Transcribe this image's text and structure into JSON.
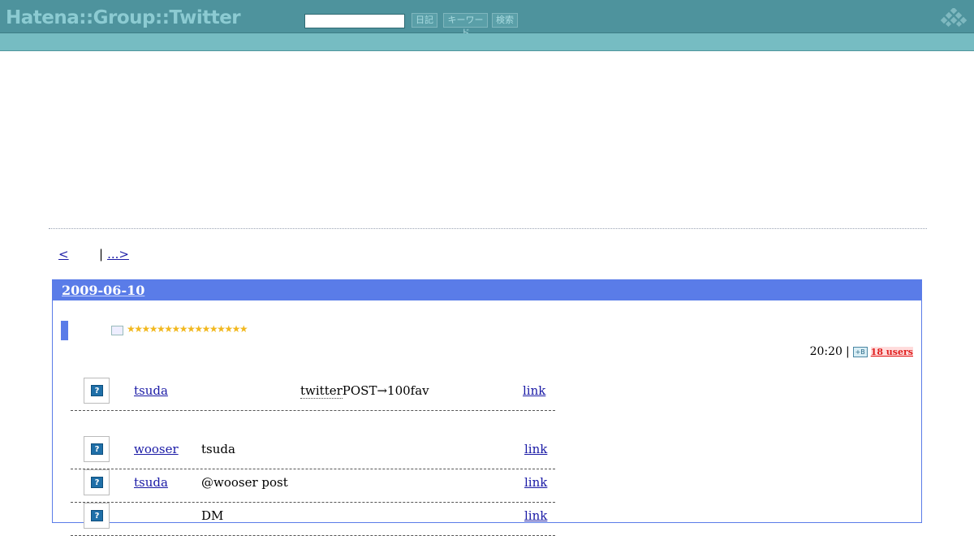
{
  "header": {
    "site_title": "Hatena::Group::Twitter",
    "search": {
      "value": "",
      "placeholder": ""
    },
    "buttons": {
      "diary": "日記",
      "keyword": "キーワード",
      "search": "検索"
    },
    "corner_icon": "hatena-diamond-logo-icon"
  },
  "pager": {
    "prev": "<",
    "separator": "|",
    "next": "...>"
  },
  "day": {
    "date": "2009-06-10",
    "star_icon": "star-icon",
    "stars": "★★★★★★★★★★★★★★★★",
    "time": "20:20",
    "meta_separator": "|",
    "bookmark_icon": "hatena-bookmark-icon",
    "users": "18 users",
    "tweets": [
      {
        "user": "tsuda",
        "text_kw": "twitter",
        "text": "POST→100fav",
        "link": "link"
      },
      {
        "user": "wooser",
        "text_kw": "",
        "text": "tsuda",
        "link": "link"
      },
      {
        "user": "tsuda",
        "text_kw": "",
        "text": "@wooser post",
        "link": "link"
      },
      {
        "user": "",
        "text_kw": "",
        "text": "DM",
        "link": "link"
      }
    ]
  },
  "colors": {
    "topbar": "#4e939d",
    "subbar": "#76bcc2",
    "day_header": "#5a7ce8",
    "link": "#1a1aa6",
    "users_badge": "#e02020",
    "star": "#f2b81f"
  }
}
